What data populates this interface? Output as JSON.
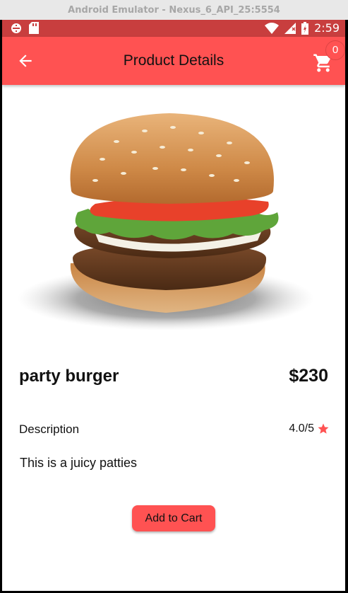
{
  "emulator": {
    "title": "Android Emulator - Nexus_6_API_25:5554"
  },
  "status_bar": {
    "time": "2:59",
    "icons_left": [
      "sync-icon",
      "sd-card-icon"
    ],
    "icons_right": [
      "wifi-icon",
      "signal-icon",
      "battery-icon"
    ]
  },
  "app_bar": {
    "title": "Product Details",
    "back_icon": "arrow-back-icon",
    "cart_icon": "shopping-cart-icon",
    "cart_count": "0",
    "color": "#ff5252"
  },
  "product": {
    "image_alt": "burger-image",
    "name": "party burger",
    "price": "$230",
    "description_label": "Description",
    "rating": "4.0/5",
    "rating_icon": "star-icon",
    "description": "This is a juicy patties"
  },
  "actions": {
    "add_to_cart": "Add to Cart"
  },
  "colors": {
    "accent": "#ff5252",
    "status_bar": "#c83e3e"
  }
}
